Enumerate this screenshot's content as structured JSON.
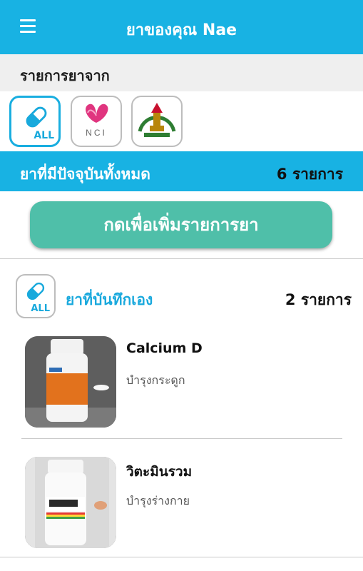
{
  "header": {
    "title": "ยาของคุณ Nae",
    "menu_icon": "hamburger-menu-icon"
  },
  "sources": {
    "heading": "รายการยาจาก",
    "items": [
      {
        "id": "all",
        "label": "ALL",
        "icon": "pill-capsule-icon",
        "active": true
      },
      {
        "id": "nci",
        "label": "NCI",
        "icon": "nci-logo",
        "active": false
      },
      {
        "id": "mahidol",
        "label": "",
        "icon": "university-crest-logo",
        "active": false
      }
    ]
  },
  "summary": {
    "label": "ยาที่มีปัจจุบันทั้งหมด",
    "count": "6 รายการ"
  },
  "add_button": {
    "label": "กดเพื่อเพิ่มรายการยา"
  },
  "section": {
    "title": "ยาที่บันทึกเอง",
    "count": "2 รายการ",
    "icon_label": "ALL"
  },
  "medicines": [
    {
      "name": "Calcium D",
      "description": "บำรุงกระดูก",
      "image": "calcium-d-bottle-photo"
    },
    {
      "name": "วิตะมินรวม",
      "description": "บำรุงร่างกาย",
      "image": "centrum-bottle-photo"
    }
  ],
  "colors": {
    "primary": "#18b2e3",
    "accent": "#4fbfa9",
    "section_title": "#1aa9dd",
    "heading_bg": "#efefef"
  }
}
